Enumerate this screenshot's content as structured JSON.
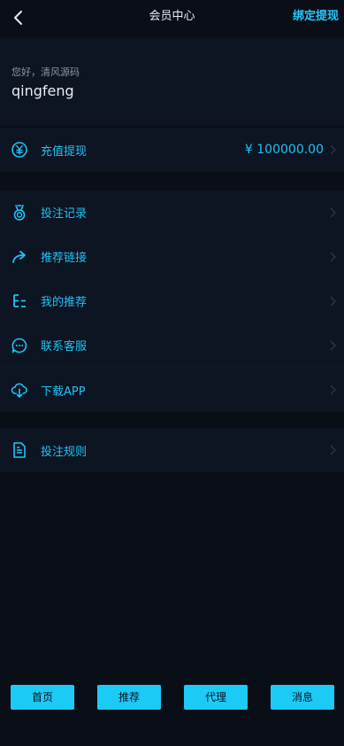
{
  "header": {
    "title": "会员中心",
    "action_label": "绑定提现"
  },
  "user": {
    "greeting": "您好，清风源码",
    "username": "qingfeng"
  },
  "balance_row": {
    "label": "充值提现",
    "value": "¥ 100000.00",
    "icon": "yuan-circle-icon"
  },
  "menu": [
    {
      "label": "投注记录",
      "icon": "medal-icon"
    },
    {
      "label": "推荐链接",
      "icon": "share-arrow-icon"
    },
    {
      "label": "我的推荐",
      "icon": "tree-list-icon"
    },
    {
      "label": "联系客服",
      "icon": "chat-bubble-icon"
    },
    {
      "label": "下载APP",
      "icon": "cloud-download-icon"
    }
  ],
  "rules_row": {
    "label": "投注规则",
    "icon": "document-icon"
  },
  "tabs": [
    "首页",
    "推荐",
    "代理",
    "消息"
  ],
  "colors": {
    "accent": "#1ec3f4",
    "background": "#0a0e17",
    "card": "#0d1422",
    "tab_button": "#1ccbf5"
  }
}
